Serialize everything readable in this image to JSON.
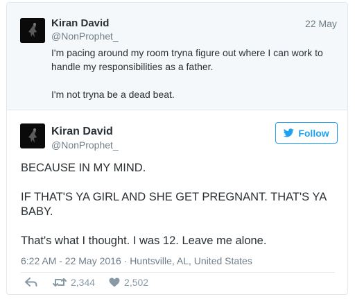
{
  "parent_tweet": {
    "name": "Kiran David",
    "handle": "@NonProphet_",
    "date": "22 May",
    "paragraphs": [
      "I'm pacing around my room tryna figure out where I can work to handle my responsibilities as a father.",
      "I'm not tryna be a dead beat."
    ]
  },
  "main_tweet": {
    "name": "Kiran David",
    "handle": "@NonProphet_",
    "follow_label": "Follow",
    "paragraphs": [
      "BECAUSE IN MY MIND.",
      "IF THAT'S YA GIRL AND SHE GET PREGNANT. THAT'S YA BABY.",
      "That's what I thought. I was 12. Leave me alone."
    ],
    "timestamp": "6:22 AM - 22 May 2016 · Huntsville, AL, United States",
    "retweets": "2,344",
    "likes": "2,502"
  },
  "icons": {
    "follow": "twitter-bird-icon",
    "reply": "reply-icon",
    "retweet": "retweet-icon",
    "like": "heart-icon"
  },
  "colors": {
    "brand_blue": "#1da1f2",
    "muted_text": "#707e88",
    "icon_gray": "#8899a6",
    "parent_bg": "#f5f8fa",
    "border": "#e1e8ed"
  }
}
